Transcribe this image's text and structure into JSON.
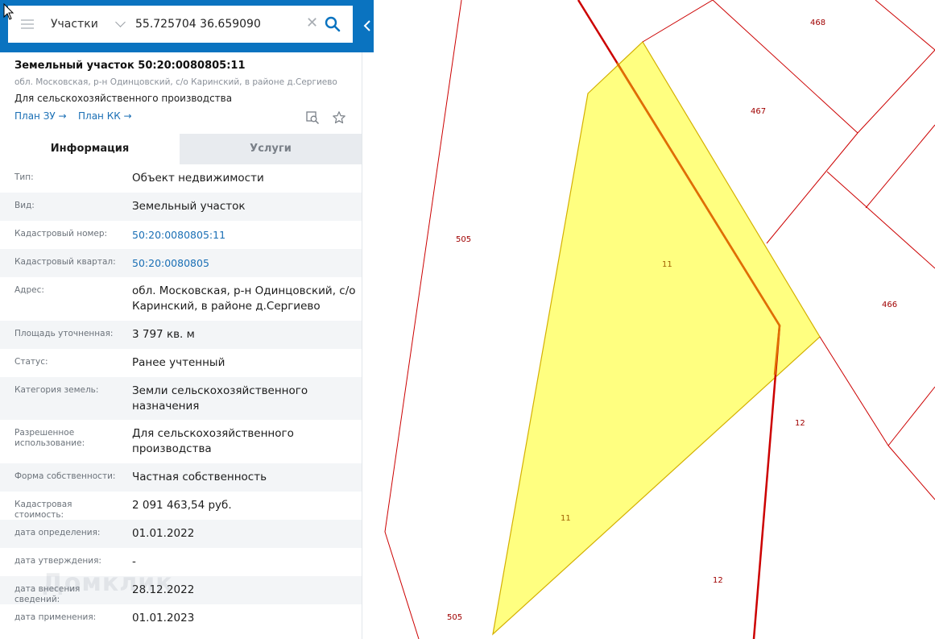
{
  "search": {
    "type_label": "Участки",
    "value": "55.725704 36.659090",
    "clear_glyph": "✕"
  },
  "object": {
    "title": "Земельный участок 50:20:0080805:11",
    "address": "обл. Московская, р-н Одинцовский, с/о Каринский, в районе д.Сергиево",
    "use": "Для сельскохозяйственного производства",
    "link_plan_zu": "План ЗУ →",
    "link_plan_kk": "План КК →"
  },
  "tabs": {
    "info": "Информация",
    "services": "Услуги"
  },
  "properties": [
    {
      "label": "Тип:",
      "value": "Объект недвижимости"
    },
    {
      "label": "Вид:",
      "value": "Земельный участок"
    },
    {
      "label": "Кадастровый номер:",
      "value": "50:20:0080805:11"
    },
    {
      "label": "Кадастровый квартал:",
      "value": "50:20:0080805"
    },
    {
      "label": "Адрес:",
      "value": "обл. Московская, р-н Одинцовский, с/о Каринский, в районе д.Сергиево"
    },
    {
      "label": "Площадь уточненная:",
      "value": "3 797 кв. м"
    },
    {
      "label": "Статус:",
      "value": "Ранее учтенный"
    },
    {
      "label": "Категория земель:",
      "value": "Земли сельскохозяйственного назначения"
    },
    {
      "label": "Разрешенное использование:",
      "value": "Для сельскохозяйственного производства"
    },
    {
      "label": "Форма собственности:",
      "value": "Частная собственность"
    },
    {
      "label": "Кадастровая стоимость:",
      "value": "2 091 463,54 руб."
    },
    {
      "label": "дата определения:",
      "value": "01.01.2022"
    },
    {
      "label": "дата утверждения:",
      "value": "-"
    },
    {
      "label": "дата внесения сведений:",
      "value": "28.12.2022"
    },
    {
      "label": "дата применения:",
      "value": "01.01.2023"
    }
  ],
  "map": {
    "labels": {
      "l468": "468",
      "l467": "467",
      "l505a": "505",
      "l505b": "505",
      "l11a": "11",
      "l11b": "11",
      "l466": "466",
      "l12a": "12",
      "l12b": "12"
    }
  },
  "watermark": "Домклик",
  "colors": {
    "header_blue": "#0a73c0",
    "link_blue": "#1a6fb5",
    "parcel_fill": "#ffff80",
    "boundary_red": "#cc0000"
  }
}
